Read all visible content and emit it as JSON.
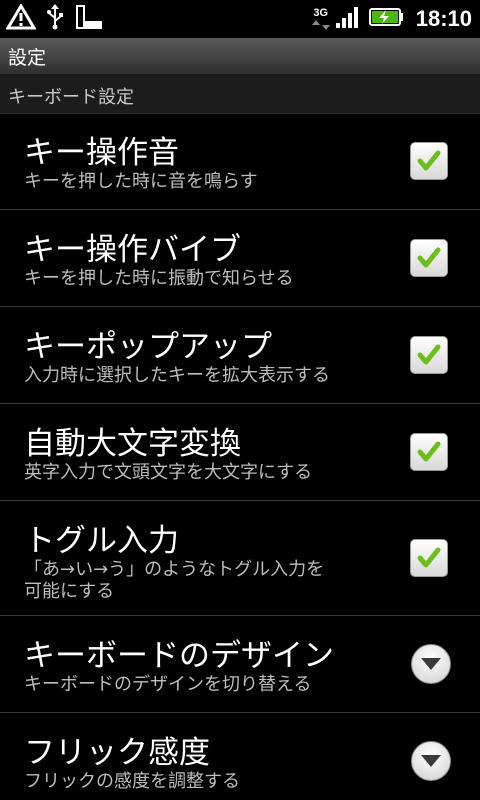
{
  "status_bar": {
    "network": "3G",
    "time": "18:10",
    "icons": [
      "warning-icon",
      "usb-icon",
      "sd-card-icon",
      "signal-icon",
      "battery-charging-icon"
    ]
  },
  "title": "設定",
  "section_header": "キーボード設定",
  "items": [
    {
      "title": "キー操作音",
      "summary": "キーを押した時に音を鳴らす",
      "control": "checkbox",
      "checked": true
    },
    {
      "title": "キー操作バイブ",
      "summary": "キーを押した時に振動で知らせる",
      "control": "checkbox",
      "checked": true
    },
    {
      "title": "キーポップアップ",
      "summary": "入力時に選択したキーを拡大表示する",
      "control": "checkbox",
      "checked": true
    },
    {
      "title": "自動大文字変換",
      "summary": "英字入力で文頭文字を大文字にする",
      "control": "checkbox",
      "checked": true
    },
    {
      "title": "トグル入力",
      "summary_line1": "「あ→い→う」のようなトグル入力を",
      "summary_line2": "可能にする",
      "control": "checkbox",
      "checked": true
    },
    {
      "title": "キーボードのデザイン",
      "summary": "キーボードのデザインを切り替える",
      "control": "dropdown"
    },
    {
      "title": "フリック感度",
      "summary": "フリックの感度を調整する",
      "control": "dropdown"
    }
  ],
  "colors": {
    "check_green": "#6cbf1a",
    "background": "#000000",
    "summary_text": "#bdbdbd"
  }
}
